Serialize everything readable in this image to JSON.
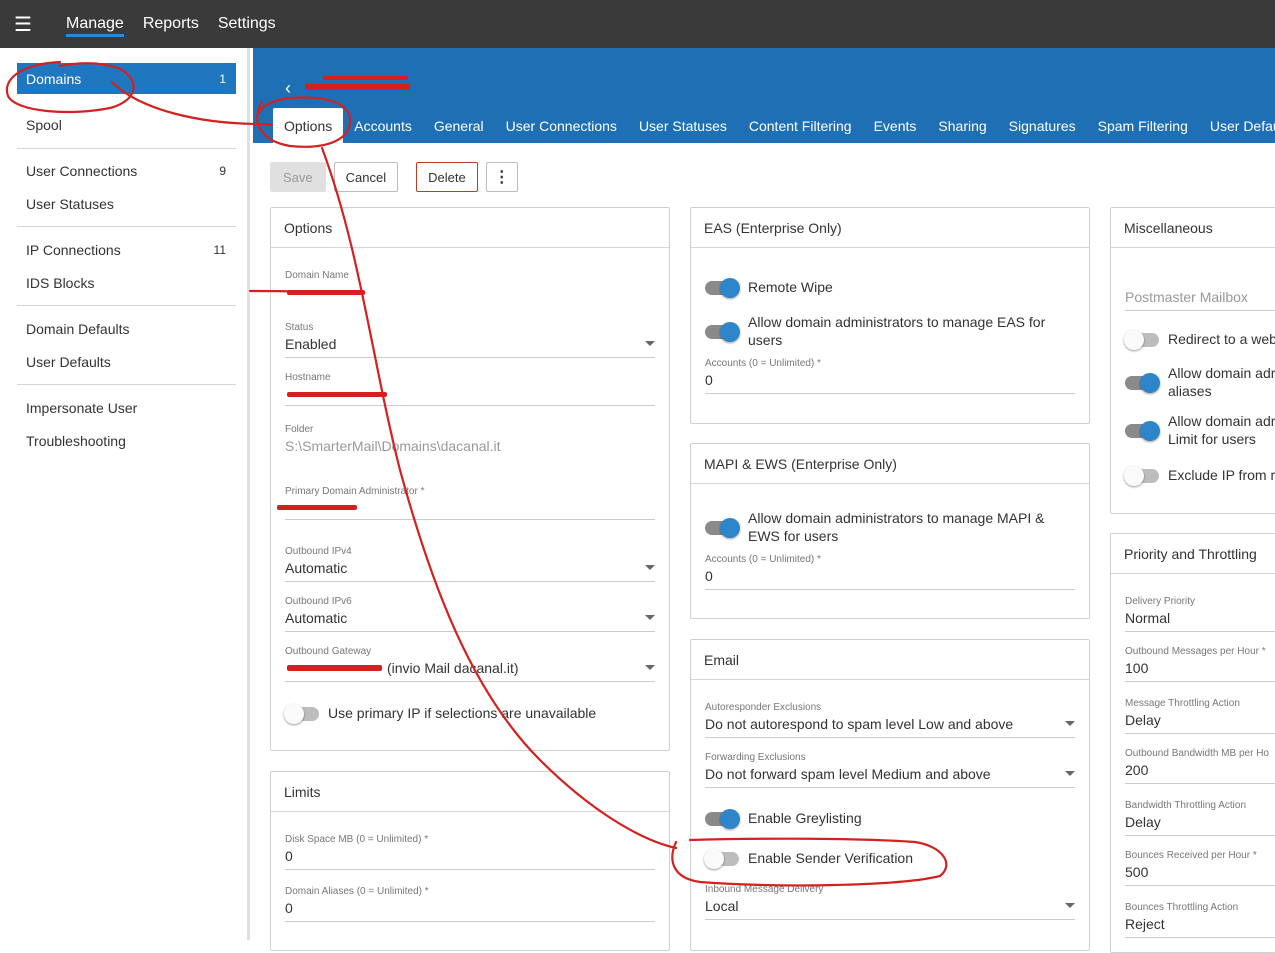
{
  "topnav": {
    "items": [
      "Manage",
      "Reports",
      "Settings"
    ]
  },
  "sidebar": {
    "items": [
      {
        "label": "Domains",
        "count": "1"
      },
      {
        "label": "Spool",
        "count": ""
      },
      {
        "label": "User Connections",
        "count": "9"
      },
      {
        "label": "User Statuses",
        "count": ""
      },
      {
        "label": "IP Connections",
        "count": "11"
      },
      {
        "label": "IDS Blocks",
        "count": ""
      },
      {
        "label": "Domain Defaults",
        "count": ""
      },
      {
        "label": "User Defaults",
        "count": ""
      },
      {
        "label": "Impersonate User",
        "count": ""
      },
      {
        "label": "Troubleshooting",
        "count": ""
      }
    ]
  },
  "header": {
    "back_icon": "‹"
  },
  "tabs": [
    "Options",
    "Accounts",
    "General",
    "User Connections",
    "User Statuses",
    "Content Filtering",
    "Events",
    "Sharing",
    "Signatures",
    "Spam Filtering",
    "User Defaults"
  ],
  "toolbar": {
    "save": "Save",
    "cancel": "Cancel",
    "delete": "Delete",
    "more": "⋮"
  },
  "options": {
    "title": "Options",
    "domain_name_label": "Domain Name",
    "status_label": "Status",
    "status_value": "Enabled",
    "hostname_label": "Hostname",
    "folder_label": "Folder",
    "folder_value": "S:\\SmarterMail\\Domains\\dacanal.it",
    "admin_label": "Primary Domain Administrator *",
    "ipv4_label": "Outbound IPv4",
    "ipv4_value": "Automatic",
    "ipv6_label": "Outbound IPv6",
    "ipv6_value": "Automatic",
    "gateway_label": "Outbound Gateway",
    "gateway_value": "(invio Mail dacanal.it)",
    "primary_ip_toggle": "Use primary IP if selections are unavailable"
  },
  "limits": {
    "title": "Limits",
    "disk_label": "Disk Space MB (0 = Unlimited) *",
    "disk_value": "0",
    "aliases_label": "Domain Aliases (0 = Unlimited) *",
    "aliases_value": "0"
  },
  "eas": {
    "title": "EAS (Enterprise Only)",
    "remote_wipe": "Remote Wipe",
    "allow_admin": "Allow domain administrators to manage EAS for users",
    "accounts_label": "Accounts (0 = Unlimited) *",
    "accounts_value": "0"
  },
  "mapi": {
    "title": "MAPI & EWS (Enterprise Only)",
    "allow_admin": "Allow domain administrators to manage MAPI & EWS for users",
    "accounts_label": "Accounts (0 = Unlimited) *",
    "accounts_value": "0"
  },
  "email": {
    "title": "Email",
    "autoresponder_label": "Autoresponder Exclusions",
    "autoresponder_value": "Do not autorespond to spam level Low and above",
    "forwarding_label": "Forwarding Exclusions",
    "forwarding_value": "Do not forward spam level Medium and above",
    "greylisting": "Enable Greylisting",
    "sender_verification": "Enable Sender Verification",
    "inbound_label": "Inbound Message Delivery",
    "inbound_value": "Local"
  },
  "misc": {
    "title": "Miscellaneous",
    "postmaster": "Postmaster Mailbox",
    "redirect": "Redirect to a web",
    "allow_aliases": "Allow domain adr aliases",
    "allow_limit": "Allow domain adr Limit for users",
    "exclude_ip": "Exclude IP from re"
  },
  "priority": {
    "title": "Priority and Throttling",
    "delivery_label": "Delivery Priority",
    "delivery_value": "Normal",
    "outmsg_label": "Outbound Messages per Hour *",
    "outmsg_value": "100",
    "msgaction_label": "Message Throttling Action",
    "msgaction_value": "Delay",
    "bandwidth_label": "Outbound Bandwidth MB per Ho",
    "bandwidth_value": "200",
    "bwaction_label": "Bandwidth Throttling Action",
    "bwaction_value": "Delay",
    "bounces_label": "Bounces Received per Hour *",
    "bounces_value": "500",
    "bounceaction_label": "Bounces Throttling Action",
    "bounceaction_value": "Reject"
  },
  "colors": {
    "header": "#1f6fb5",
    "accent": "#2d86c9",
    "topbar": "#3a3a3a",
    "annotation": "#d42020"
  }
}
